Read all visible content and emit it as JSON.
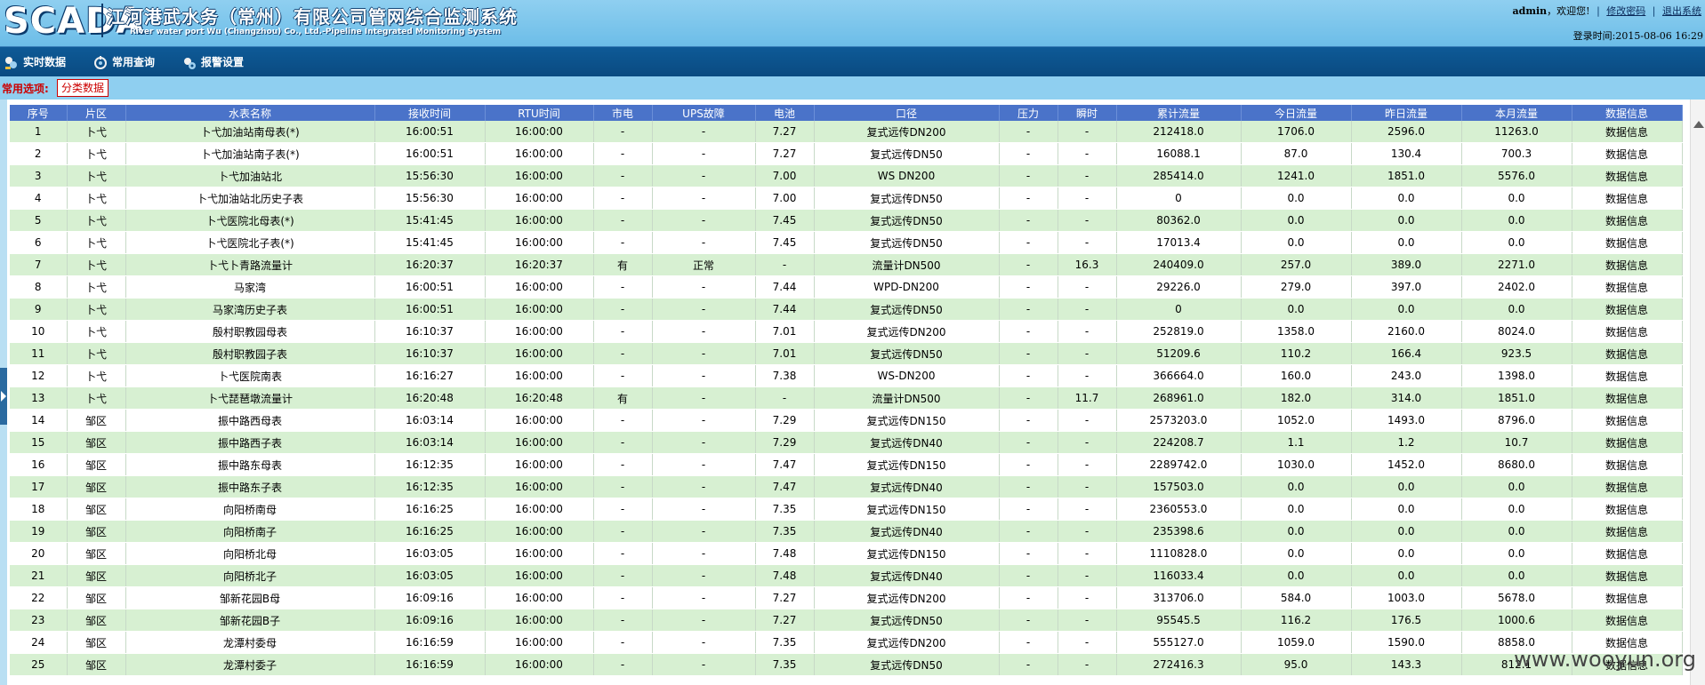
{
  "header": {
    "logo": "SCADA",
    "title_cn": "江河港武水务（常州）有限公司管网综合监测系统",
    "title_en": "River water port Wu (Changzhou) Co., Ltd.-Pipeline Integrated Monitoring System",
    "user": "admin",
    "welcome": "，欢迎您!",
    "change_password": "修改密码",
    "logout": "退出系统",
    "login_time_label": "登录时间:",
    "login_time": "2015-08-06 16:29"
  },
  "menu": [
    {
      "label": "实时数据",
      "icon": "realtime-data-icon"
    },
    {
      "label": "常用查询",
      "icon": "query-icon"
    },
    {
      "label": "报警设置",
      "icon": "alarm-settings-icon"
    }
  ],
  "options": {
    "label": "常用选项:",
    "tab": "分类数据"
  },
  "table": {
    "headers": [
      "序号",
      "片区",
      "水表名称",
      "接收时间",
      "RTU时间",
      "市电",
      "UPS故障",
      "电池",
      "口径",
      "压力",
      "瞬时",
      "累计流量",
      "今日流量",
      "昨日流量",
      "本月流量",
      "数据信息"
    ],
    "rows": [
      [
        "1",
        "卜弋",
        "卜弋加油站南母表(*)",
        "16:00:51",
        "16:00:00",
        "-",
        "-",
        "7.27",
        "复式远传DN200",
        "-",
        "-",
        "212418.0",
        "1706.0",
        "2596.0",
        "11263.0",
        "数据信息"
      ],
      [
        "2",
        "卜弋",
        "卜弋加油站南子表(*)",
        "16:00:51",
        "16:00:00",
        "-",
        "-",
        "7.27",
        "复式远传DN50",
        "-",
        "-",
        "16088.1",
        "87.0",
        "130.4",
        "700.3",
        "数据信息"
      ],
      [
        "3",
        "卜弋",
        "卜弋加油站北",
        "15:56:30",
        "16:00:00",
        "-",
        "-",
        "7.00",
        "WS DN200",
        "-",
        "-",
        "285414.0",
        "1241.0",
        "1851.0",
        "5576.0",
        "数据信息"
      ],
      [
        "4",
        "卜弋",
        "卜弋加油站北历史子表",
        "15:56:30",
        "16:00:00",
        "-",
        "-",
        "7.00",
        "复式远传DN50",
        "-",
        "-",
        "0",
        "0.0",
        "0.0",
        "0.0",
        "数据信息"
      ],
      [
        "5",
        "卜弋",
        "卜弋医院北母表(*)",
        "15:41:45",
        "16:00:00",
        "-",
        "-",
        "7.45",
        "复式远传DN50",
        "-",
        "-",
        "80362.0",
        "0.0",
        "0.0",
        "0.0",
        "数据信息"
      ],
      [
        "6",
        "卜弋",
        "卜弋医院北子表(*)",
        "15:41:45",
        "16:00:00",
        "-",
        "-",
        "7.45",
        "复式远传DN50",
        "-",
        "-",
        "17013.4",
        "0.0",
        "0.0",
        "0.0",
        "数据信息"
      ],
      [
        "7",
        "卜弋",
        "卜弋卜青路流量计",
        "16:20:37",
        "16:20:37",
        "有",
        "正常",
        "-",
        "流量计DN500",
        "-",
        "16.3",
        "240409.0",
        "257.0",
        "389.0",
        "2271.0",
        "数据信息"
      ],
      [
        "8",
        "卜弋",
        "马家湾",
        "16:00:51",
        "16:00:00",
        "-",
        "-",
        "7.44",
        "WPD-DN200",
        "-",
        "-",
        "29226.0",
        "279.0",
        "397.0",
        "2402.0",
        "数据信息"
      ],
      [
        "9",
        "卜弋",
        "马家湾历史子表",
        "16:00:51",
        "16:00:00",
        "-",
        "-",
        "7.44",
        "复式远传DN50",
        "-",
        "-",
        "0",
        "0.0",
        "0.0",
        "0.0",
        "数据信息"
      ],
      [
        "10",
        "卜弋",
        "殷村职教园母表",
        "16:10:37",
        "16:00:00",
        "-",
        "-",
        "7.01",
        "复式远传DN200",
        "-",
        "-",
        "252819.0",
        "1358.0",
        "2160.0",
        "8024.0",
        "数据信息"
      ],
      [
        "11",
        "卜弋",
        "殷村职教园子表",
        "16:10:37",
        "16:00:00",
        "-",
        "-",
        "7.01",
        "复式远传DN50",
        "-",
        "-",
        "51209.6",
        "110.2",
        "166.4",
        "923.5",
        "数据信息"
      ],
      [
        "12",
        "卜弋",
        "卜弋医院南表",
        "16:16:27",
        "16:00:00",
        "-",
        "-",
        "7.38",
        "WS-DN200",
        "-",
        "-",
        "366664.0",
        "160.0",
        "243.0",
        "1398.0",
        "数据信息"
      ],
      [
        "13",
        "卜弋",
        "卜弋琵琶墩流量计",
        "16:20:48",
        "16:20:48",
        "有",
        "-",
        "-",
        "流量计DN500",
        "-",
        "11.7",
        "268961.0",
        "182.0",
        "314.0",
        "1851.0",
        "数据信息"
      ],
      [
        "14",
        "邹区",
        "振中路西母表",
        "16:03:14",
        "16:00:00",
        "-",
        "-",
        "7.29",
        "复式远传DN150",
        "-",
        "-",
        "2573203.0",
        "1052.0",
        "1493.0",
        "8796.0",
        "数据信息"
      ],
      [
        "15",
        "邹区",
        "振中路西子表",
        "16:03:14",
        "16:00:00",
        "-",
        "-",
        "7.29",
        "复式远传DN40",
        "-",
        "-",
        "224208.7",
        "1.1",
        "1.2",
        "10.7",
        "数据信息"
      ],
      [
        "16",
        "邹区",
        "振中路东母表",
        "16:12:35",
        "16:00:00",
        "-",
        "-",
        "7.47",
        "复式远传DN150",
        "-",
        "-",
        "2289742.0",
        "1030.0",
        "1452.0",
        "8680.0",
        "数据信息"
      ],
      [
        "17",
        "邹区",
        "振中路东子表",
        "16:12:35",
        "16:00:00",
        "-",
        "-",
        "7.47",
        "复式远传DN40",
        "-",
        "-",
        "157503.0",
        "0.0",
        "0.0",
        "0.0",
        "数据信息"
      ],
      [
        "18",
        "邹区",
        "向阳桥南母",
        "16:16:25",
        "16:00:00",
        "-",
        "-",
        "7.35",
        "复式远传DN150",
        "-",
        "-",
        "2360553.0",
        "0.0",
        "0.0",
        "0.0",
        "数据信息"
      ],
      [
        "19",
        "邹区",
        "向阳桥南子",
        "16:16:25",
        "16:00:00",
        "-",
        "-",
        "7.35",
        "复式远传DN40",
        "-",
        "-",
        "235398.6",
        "0.0",
        "0.0",
        "0.0",
        "数据信息"
      ],
      [
        "20",
        "邹区",
        "向阳桥北母",
        "16:03:05",
        "16:00:00",
        "-",
        "-",
        "7.48",
        "复式远传DN150",
        "-",
        "-",
        "1110828.0",
        "0.0",
        "0.0",
        "0.0",
        "数据信息"
      ],
      [
        "21",
        "邹区",
        "向阳桥北子",
        "16:03:05",
        "16:00:00",
        "-",
        "-",
        "7.48",
        "复式远传DN40",
        "-",
        "-",
        "116033.4",
        "0.0",
        "0.0",
        "0.0",
        "数据信息"
      ],
      [
        "22",
        "邹区",
        "邹新花园B母",
        "16:09:16",
        "16:00:00",
        "-",
        "-",
        "7.27",
        "复式远传DN200",
        "-",
        "-",
        "313706.0",
        "584.0",
        "1003.0",
        "5678.0",
        "数据信息"
      ],
      [
        "23",
        "邹区",
        "邹新花园B子",
        "16:09:16",
        "16:00:00",
        "-",
        "-",
        "7.27",
        "复式远传DN50",
        "-",
        "-",
        "95545.5",
        "116.2",
        "176.5",
        "1000.6",
        "数据信息"
      ],
      [
        "24",
        "邹区",
        "龙潭村委母",
        "16:16:59",
        "16:00:00",
        "-",
        "-",
        "7.35",
        "复式远传DN200",
        "-",
        "-",
        "555127.0",
        "1059.0",
        "1590.0",
        "8858.0",
        "数据信息"
      ],
      [
        "25",
        "邹区",
        "龙潭村委子",
        "16:16:59",
        "16:00:00",
        "-",
        "-",
        "7.35",
        "复式远传DN50",
        "-",
        "-",
        "272416.3",
        "95.0",
        "143.3",
        "812.1",
        "数据信息"
      ]
    ]
  },
  "watermark": "www.wooyun.org",
  "colors": {
    "header_bg": "#8fcff0",
    "menu_bg": "#0a4a80",
    "table_header_bg": "#4a73c9",
    "row_odd_bg": "#d7f0d2",
    "option_text": "#cc0000"
  }
}
